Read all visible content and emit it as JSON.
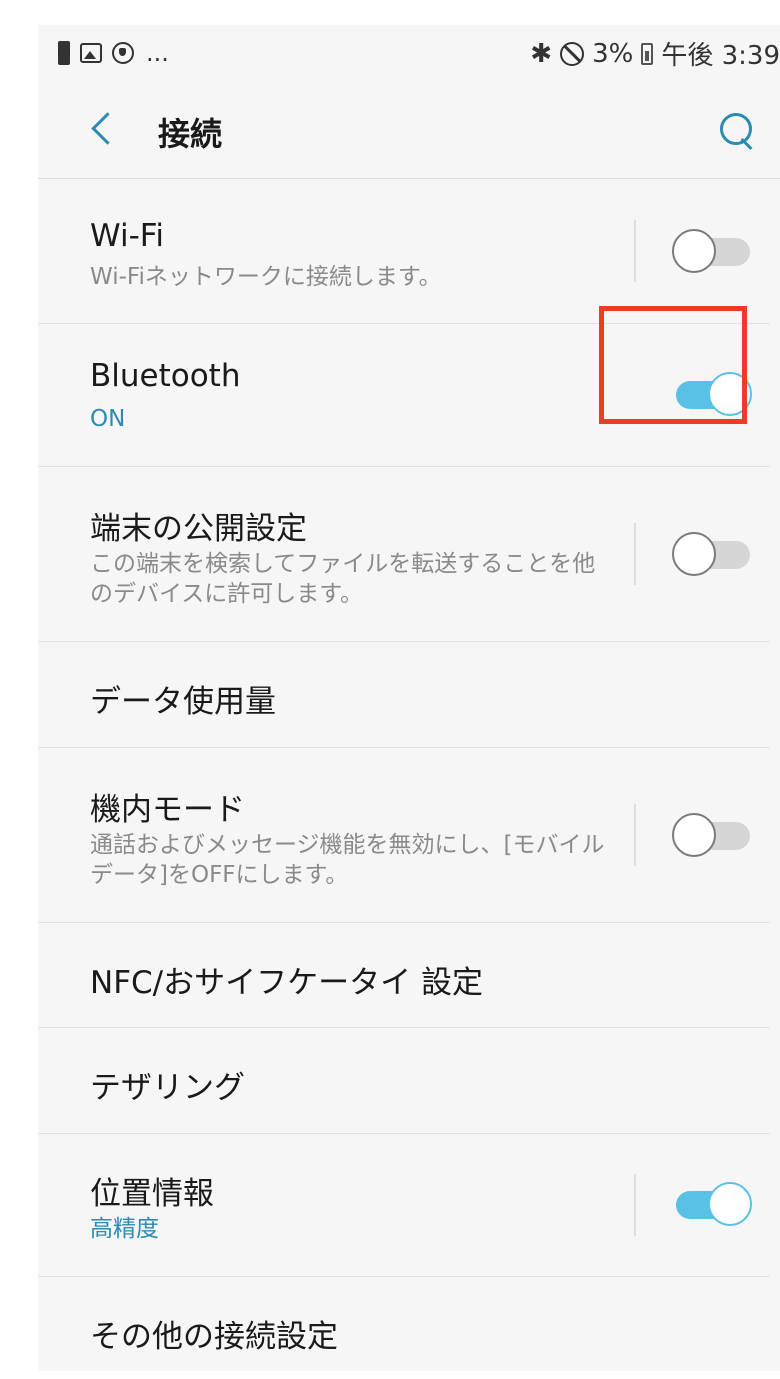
{
  "status_bar": {
    "left_icons": [
      "battery-small-icon",
      "image-icon",
      "shield-icon"
    ],
    "overflow": "...",
    "bluetooth_glyph": "✱",
    "battery_percent": "3%",
    "time": "午後 3:39"
  },
  "app_bar": {
    "title": "接続"
  },
  "items": [
    {
      "title": "Wi-Fi",
      "subtitle": "Wi-Fiネットワークに接続します。",
      "toggle": "off"
    },
    {
      "title": "Bluetooth",
      "subtitle": "ON",
      "toggle": "on",
      "subtitle_accent": true
    },
    {
      "title": "端末の公開設定",
      "subtitle": "この端末を検索してファイルを転送することを他のデバイスに許可します。",
      "toggle": "off"
    },
    {
      "title": "データ使用量"
    },
    {
      "title": "機内モード",
      "subtitle": "通話およびメッセージ機能を無効にし、[モバイルデータ]をOFFにします。",
      "toggle": "off"
    },
    {
      "title": "NFC/おサイフケータイ 設定"
    },
    {
      "title": "テザリング"
    },
    {
      "title": "位置情報",
      "subtitle": "高精度",
      "toggle": "on",
      "subtitle_accent": true
    },
    {
      "title": "その他の接続設定"
    }
  ],
  "colors": {
    "accent": "#2c8bb0",
    "toggle_on": "#5ac1e6",
    "highlight": "#f03a28"
  }
}
